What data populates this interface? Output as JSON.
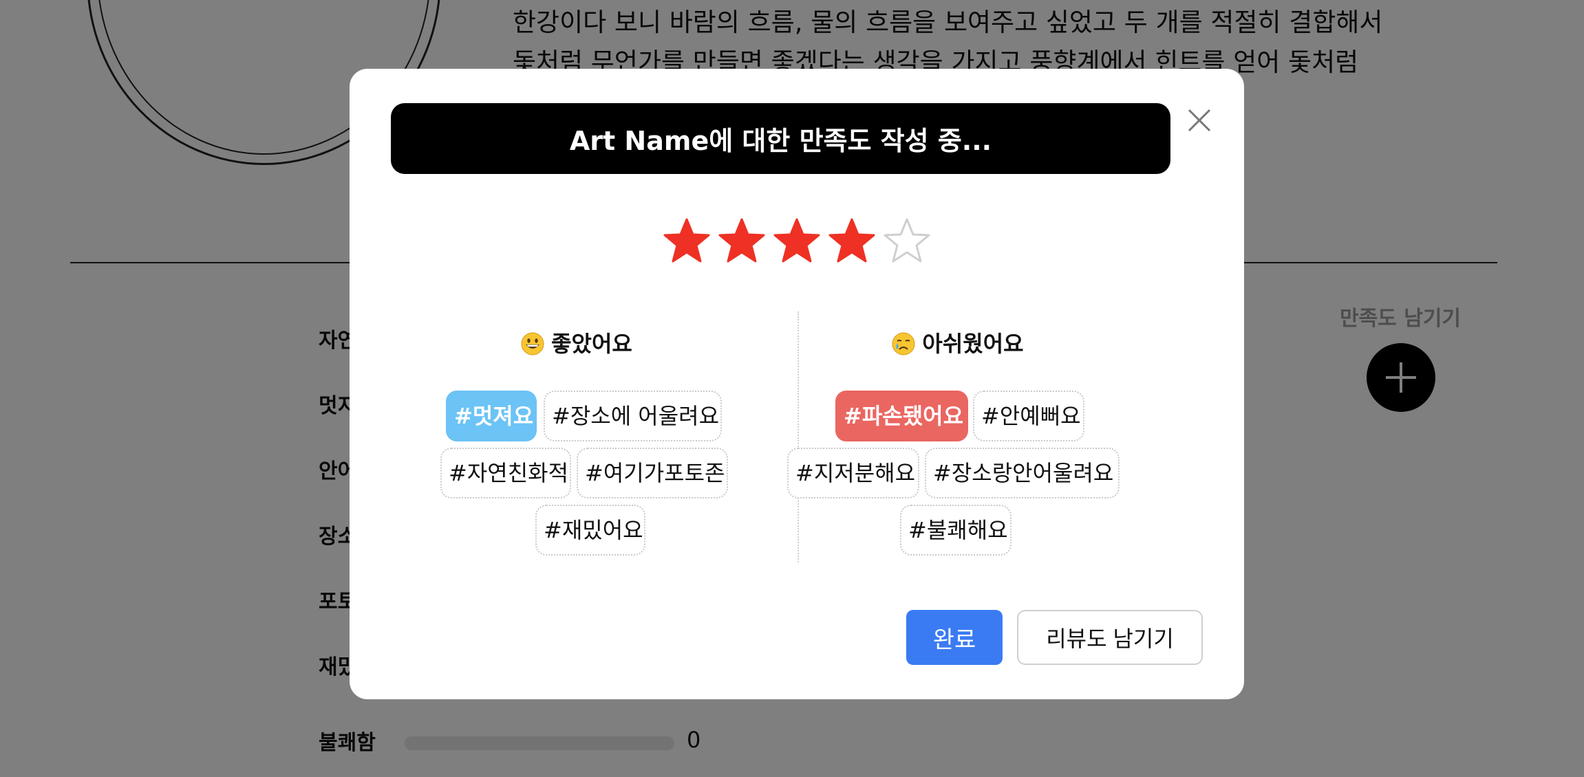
{
  "background": {
    "description_line1": "한강이다 보니 바람의 흐름, 물의 흐름을 보여주고 싶었고 두 개를 적절히 결합해서",
    "description_line2": "돛처럼 무언가를 만들면 좋겠다는 생각을 가지고 풍향계에서 힌트를 얻어 돛처럼",
    "rate_label": "만족도 남기기",
    "stats": [
      {
        "label": "자연"
      },
      {
        "label": "멋지"
      },
      {
        "label": "안어"
      },
      {
        "label": "장소"
      },
      {
        "label": "포토"
      },
      {
        "label": "재밌"
      },
      {
        "label": "불쾌함",
        "count": "0"
      }
    ]
  },
  "modal": {
    "title": "Art Name에 대한 만족도 작성 중...",
    "rating": 4,
    "max_rating": 5,
    "star_color": "#ee3124",
    "positive": {
      "heading": "좋았어요",
      "emoji": "grinning-face-emoji",
      "tags": [
        "#멋져요",
        "#장소에 어울려요",
        "#자연친화적",
        "#여기가포토존",
        "#재밌어요"
      ],
      "selected": [
        "#멋져요"
      ],
      "selected_color": "#6cc3f5"
    },
    "negative": {
      "heading": "아쉬웠어요",
      "emoji": "crying-face-emoji",
      "tags": [
        "#파손됐어요",
        "#안예뻐요",
        "#지저분해요",
        "#장소랑안어울려요",
        "#불쾌해요"
      ],
      "selected": [
        "#파손됐어요"
      ],
      "selected_color": "#ea6661"
    },
    "done_label": "완료",
    "review_label": "리뷰도 남기기",
    "done_color": "#3a7bf4"
  }
}
